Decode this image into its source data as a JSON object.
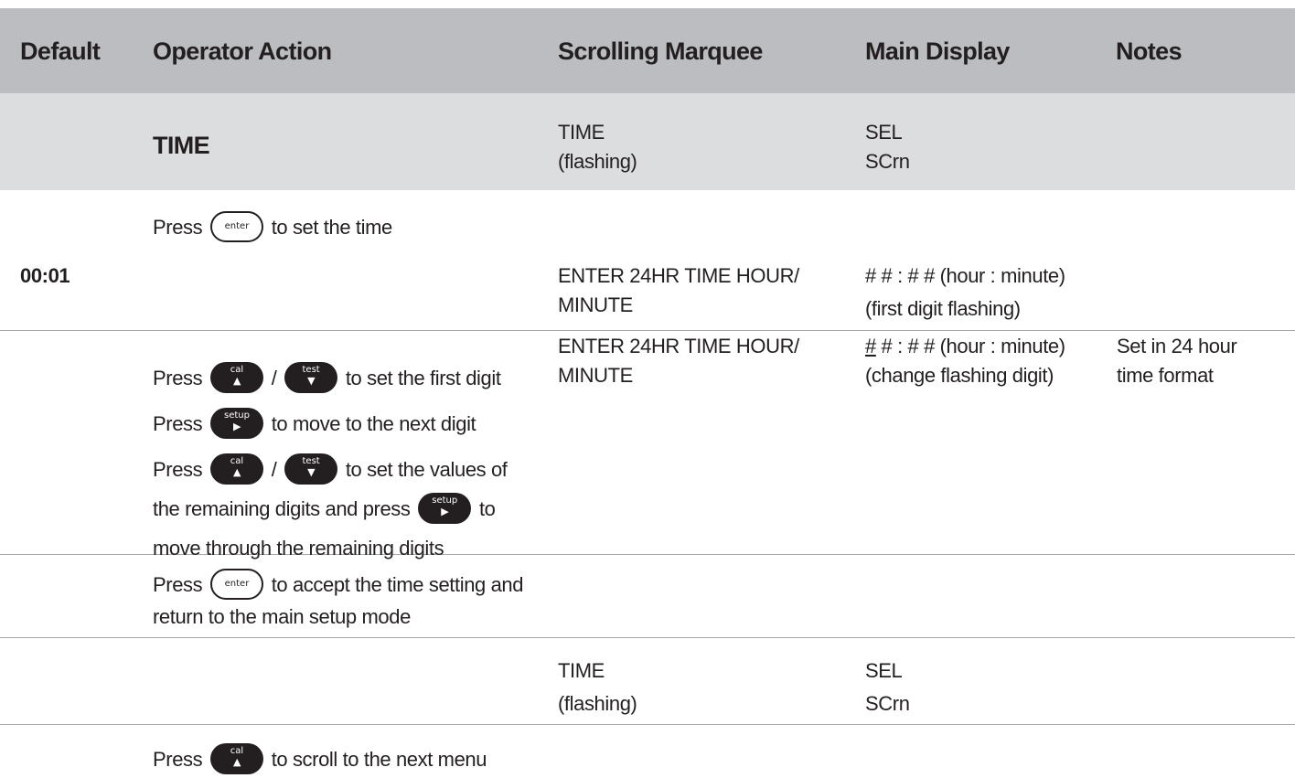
{
  "table": {
    "headers": {
      "default": "Default",
      "operator_action": "Operator Action",
      "scrolling_marquee": "Scrolling Marquee",
      "main_display": "Main Display",
      "notes": "Notes"
    },
    "section": {
      "title": "TIME",
      "marquee_1": "TIME",
      "marquee_2": "(flashing)",
      "display_1": "SEL",
      "display_2": "SCrn"
    },
    "rows": [
      {
        "action_pre": "Press",
        "action_post": "to set the time"
      },
      {
        "default": "00:01",
        "marquee_1": "ENTER 24HR TIME HOUR/",
        "marquee_2": "MINUTE",
        "display_1": "# # : # #  (hour : minute)",
        "display_2": "(first digit flashing)"
      },
      {
        "action_1_pre": "Press",
        "action_1_mid": "/",
        "action_1_post": "to set the first digit",
        "action_2_pre": "Press",
        "action_2_post": "to move to the next digit",
        "action_3_pre": "Press",
        "action_3_mid": "/",
        "action_3_post": "to set the values of",
        "action_4_pre": "the remaining digits and press",
        "action_4_post": "to",
        "action_5": "move through the remaining digits",
        "marquee_1": "ENTER 24HR TIME HOUR/",
        "marquee_2": "MINUTE",
        "display_1_underlined": "#",
        "display_1_rest": " # : # #  (hour : minute)",
        "display_2": "(change flashing digit)",
        "notes_1": "Set in 24 hour",
        "notes_2": "time format"
      },
      {
        "action_1_pre": "Press",
        "action_1_post": "to accept the time setting and",
        "action_2": "return to the main setup mode"
      },
      {
        "marquee_1": "TIME",
        "marquee_2": "(flashing)",
        "display_1": "SEL",
        "display_2": "SCrn"
      },
      {
        "action_pre": "Press",
        "action_post": "to scroll to the next menu"
      }
    ]
  },
  "keys": {
    "enter": {
      "label": "enter",
      "icon": "enter-key-icon"
    },
    "cal": {
      "label": "cal",
      "glyph": "▲",
      "icon": "cal-up-key-icon"
    },
    "test": {
      "label": "test",
      "glyph": "▼",
      "icon": "test-down-key-icon"
    },
    "setup": {
      "label": "setup",
      "glyph": "▶",
      "icon": "setup-right-key-icon"
    }
  },
  "colors": {
    "header_bg": "#bcbdc0",
    "section_bg": "#dcdddf",
    "text": "#231f20",
    "divider": "#a7a9ac"
  }
}
